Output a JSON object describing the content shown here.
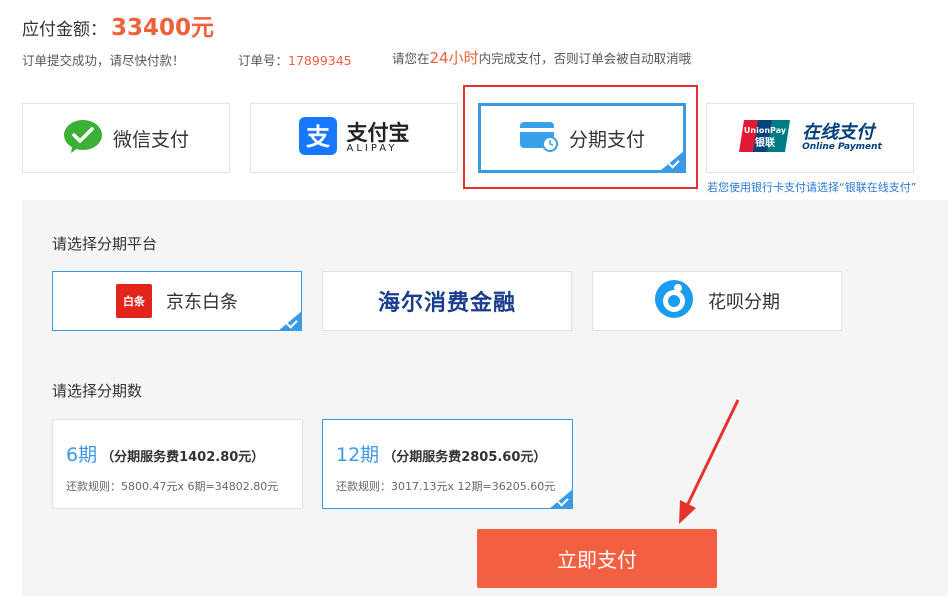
{
  "header": {
    "amount_label": "应付金额：",
    "amount_value": "33400元"
  },
  "notice": {
    "submitted_text": "订单提交成功，请尽快付款！",
    "order_label": "订单号：",
    "order_number": "17899345",
    "deadline_prefix": "请您在",
    "deadline_hours": "24小时",
    "deadline_suffix": "内完成支付，否则订单会被自动取消哦"
  },
  "payment_methods": {
    "wechat": "微信支付",
    "alipay_cn": "支付宝",
    "alipay_en": "ALIPAY",
    "installment": "分期支付",
    "unionpay_cn": "在线支付",
    "unionpay_en": "Online Payment",
    "unionpay_logo_en": "UnionPay",
    "unionpay_logo_cn": "银联",
    "unionpay_tip": "若您使用银行卡支付请选择“银联在线支付”"
  },
  "platforms": {
    "title": "请选择分期平台",
    "jd_logo": "白条",
    "jd_label": "京东白条",
    "haier_label": "海尔消费金融",
    "huabei_label": "花呗分期"
  },
  "terms": {
    "title": "请选择分期数",
    "items": [
      {
        "period": "6期",
        "fee": "（分期服务费1402.80元）",
        "rule": "还款规则：5800.47元x 6期=34802.80元"
      },
      {
        "period": "12期",
        "fee": "（分期服务费2805.60元）",
        "rule": "还款规则：3017.13元x 12期=36205.60元"
      }
    ]
  },
  "actions": {
    "pay_now": "立即支付"
  },
  "colors": {
    "accent_blue": "#3b9ae6",
    "accent_orange": "#f0603c",
    "annotation_red": "#e5322d"
  }
}
